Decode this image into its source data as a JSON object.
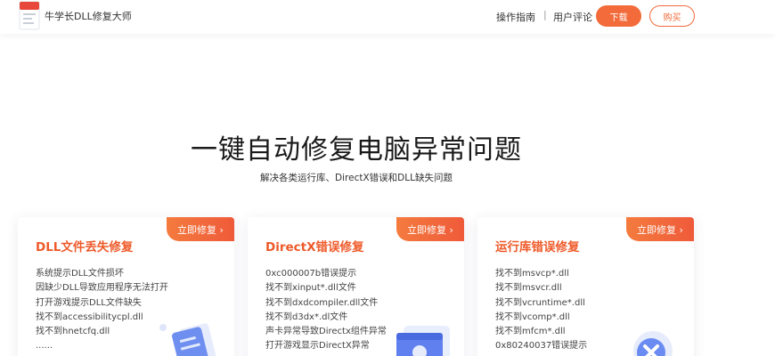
{
  "header": {
    "app_name": "牛学长DLL修复大师",
    "nav_guide": "操作指南",
    "nav_separator": "|",
    "nav_review": "用户评论",
    "download_label": "下载",
    "buy_label": "购买"
  },
  "hero": {
    "title": "一键自动修复电脑异常问题",
    "subtitle": "解决各类运行库、DirectX错误和DLL缺失问题"
  },
  "cards": [
    {
      "badge": "立即修复 ›",
      "title": "DLL文件丢失修复",
      "items": [
        "系统提示DLL文件损坏",
        "因缺少DLL导致应用程序无法打开",
        "打开游戏提示DLL文件缺失",
        "找不到accessibilitycpl.dll",
        "找不到hnetcfq.dll",
        "......"
      ]
    },
    {
      "badge": "立即修复 ›",
      "title": "DirectX错误修复",
      "items": [
        "0xc000007b错误提示",
        "找不到xinput*.dll文件",
        "找不到dxdcompiler.dll文件",
        "找不到d3dx*.dl文件",
        "声卡异常导致Directx组件异常",
        "打开游戏显示DirectX异常"
      ]
    },
    {
      "badge": "立即修复 ›",
      "title": "运行库错误修复",
      "items": [
        "找不到msvcp*.dll",
        "找不到msvcr.dll",
        "找不到vcruntime*.dll",
        "找不到vcomp*.dll",
        "找不到mfcm*.dll",
        "0x80240037错误提示"
      ]
    }
  ],
  "colors": {
    "accent": "#f36b3a",
    "card_title": "#ee5a2a"
  }
}
